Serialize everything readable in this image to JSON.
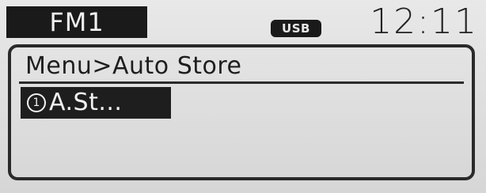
{
  "status": {
    "band": "FM1",
    "source_badge": "USB",
    "clock": "12:11"
  },
  "menu": {
    "title": "Menu>Auto Store",
    "items": [
      {
        "number": "1",
        "label": "A.St..."
      }
    ]
  },
  "colors": {
    "screen_bg": "#dcdcdc",
    "dark": "#1e1e1e",
    "inverted_text": "#f2f2f2"
  }
}
